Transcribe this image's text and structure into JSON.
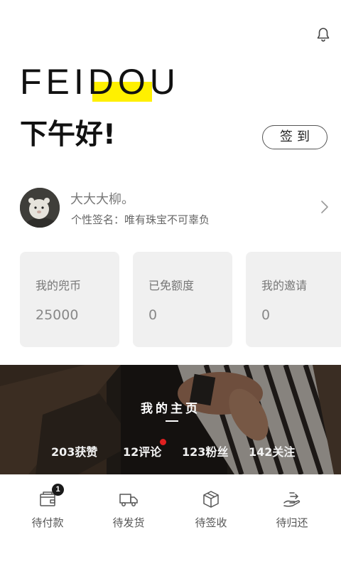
{
  "header": {
    "logo_text": "FEIDOU",
    "greeting": "下午好!",
    "signin_label": "签到"
  },
  "profile": {
    "username": "大大大柳。",
    "signature": "个性签名：唯有珠宝不可辜负"
  },
  "cards": [
    {
      "title": "我的兜币",
      "value": "25000"
    },
    {
      "title": "已免额度",
      "value": "0"
    },
    {
      "title": "我的邀请",
      "value": "0"
    }
  ],
  "banner": {
    "title": "我的主页",
    "stats": {
      "likes": "203获赞",
      "comments": "12评论",
      "fans": "123粉丝",
      "follows": "142关注"
    }
  },
  "tabs": [
    {
      "label": "待付款",
      "icon": "wallet-icon",
      "badge": "1"
    },
    {
      "label": "待发货",
      "icon": "truck-icon"
    },
    {
      "label": "待签收",
      "icon": "package-icon"
    },
    {
      "label": "待归还",
      "icon": "return-hand-icon"
    }
  ],
  "colors": {
    "accent_yellow": "#fff000",
    "notification_red": "#e02020",
    "card_bg": "#f0f0f0"
  }
}
